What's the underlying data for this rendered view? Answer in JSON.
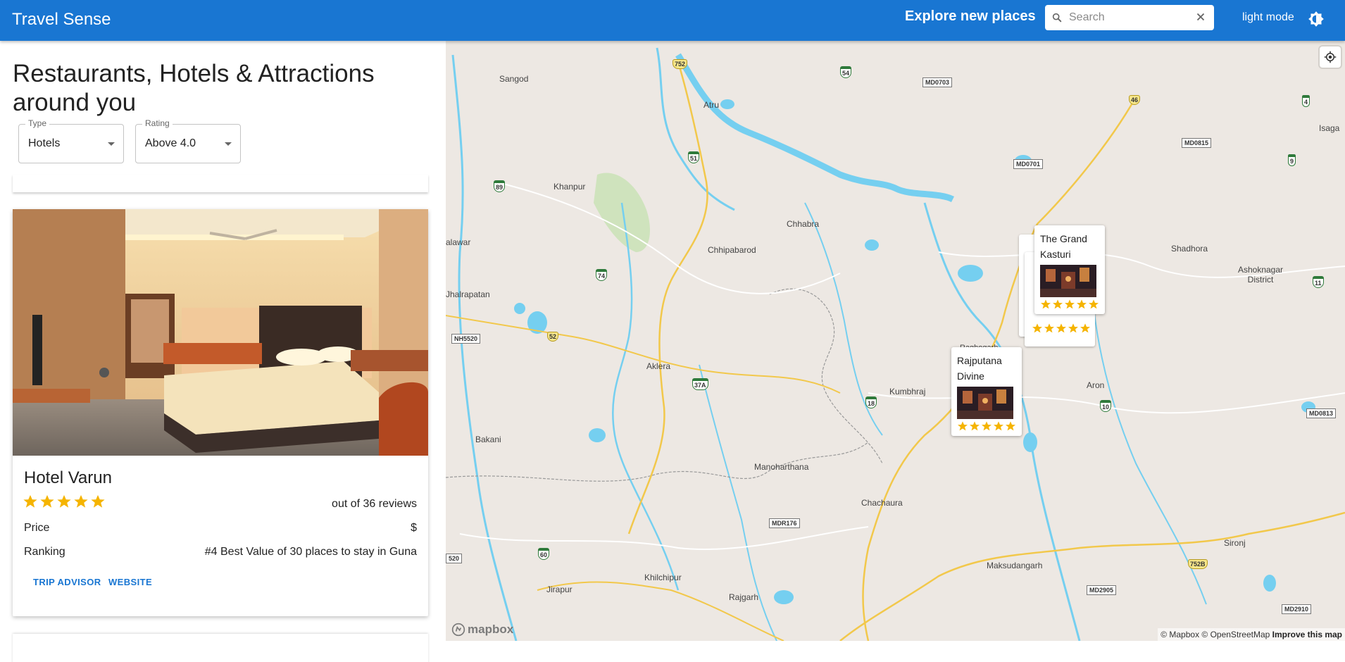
{
  "app": {
    "title": "Travel Sense"
  },
  "header": {
    "explore_label": "Explore new places",
    "search_placeholder": "Search",
    "mode_label": "light mode"
  },
  "sidebar": {
    "heading": "Restaurants, Hotels & Attractions around you",
    "filters": {
      "type": {
        "label": "Type",
        "value": "Hotels"
      },
      "rating": {
        "label": "Rating",
        "value": "Above 4.0"
      }
    }
  },
  "hotel_card": {
    "name": "Hotel Varun",
    "rating": 5,
    "reviews": "out of 36 reviews",
    "price_label": "Price",
    "price_value": "$",
    "ranking_label": "Ranking",
    "ranking_value": "#4 Best Value of 30 places to stay in Guna",
    "tripadvisor_label": "TRIP ADVISOR",
    "website_label": "WEBSITE"
  },
  "map": {
    "places": [
      "Sangod",
      "Atru",
      "Khanpur",
      "Chhabra",
      "Chhipabarod",
      "alawar",
      "Jhalrapatan",
      "Aklera",
      "Bakani",
      "Kumbhraj",
      "Manoharthana",
      "Chachaura",
      "Khilchipur",
      "Rajgarh",
      "Jirapur",
      "Maksudangarh",
      "Sironj",
      "Aron",
      "Shadhora",
      "Ashoknagar District",
      "Isaga",
      "Raghogarh"
    ],
    "road_labels": [
      "752",
      "54",
      "MD0703",
      "46",
      "4",
      "51",
      "89",
      "MD0815",
      "MD0701",
      "9",
      "52",
      "NH5520",
      "74",
      "37A",
      "18",
      "10",
      "MD0813",
      "MDR176",
      "60",
      "MD2905",
      "752B",
      "MD2910",
      "11",
      "520"
    ],
    "markers": [
      {
        "name": "The Grand Kasturi",
        "rating": 5
      },
      {
        "name": "Rajputana Divine",
        "rating": 5
      }
    ],
    "logo": "mapbox",
    "attribution": "© Mapbox © OpenStreetMap",
    "improve_link": "Improve this map"
  },
  "colors": {
    "appbar": "#1976d2",
    "star": "#f5b400",
    "water": "#75cff0",
    "road": "#f2c84b"
  }
}
